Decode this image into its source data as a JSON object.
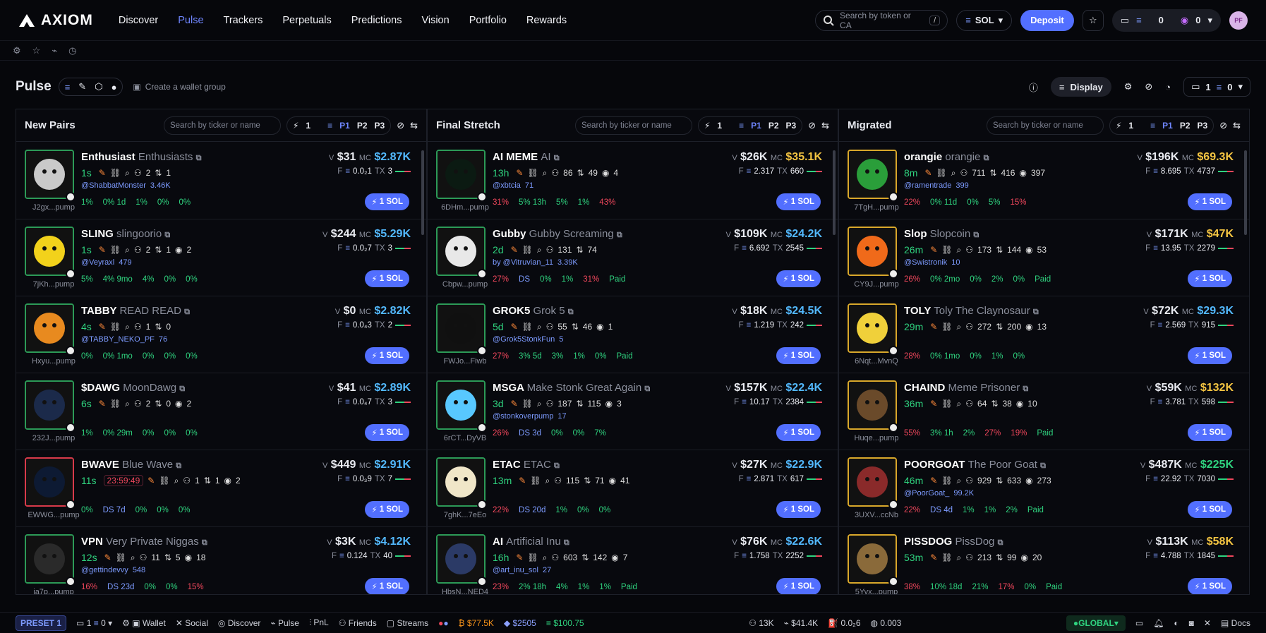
{
  "brand": {
    "name": "AXIOM"
  },
  "nav": [
    "Discover",
    "Pulse",
    "Trackers",
    "Perpetuals",
    "Predictions",
    "Vision",
    "Portfolio",
    "Rewards"
  ],
  "search": {
    "placeholder": "Search by token or CA",
    "shortcut": "/"
  },
  "chain": "SOL",
  "deposit_label": "Deposit",
  "wallet": {
    "balance1": "0",
    "balance2": "0"
  },
  "avatar": "PF",
  "pulse": {
    "title": "Pulse",
    "create_group": "Create a wallet group",
    "display": "Display",
    "boxcount": "1",
    "boxbal": "0"
  },
  "columns": [
    {
      "title": "New Pairs",
      "search_placeholder": "Search by ticker or name",
      "count": "1",
      "cards": [
        {
          "ticker": "Enthusiast",
          "name": "Enthusiasts",
          "age": "1s",
          "addr": "J2gx...pump",
          "handle": "@ShabbatMonster",
          "followers": "3.46K",
          "v": "$31",
          "mc": "$2.87K",
          "f": "0.0₂1",
          "tx": "3",
          "stats": [
            "1%",
            "0% 1d",
            "1%",
            "0%",
            "0%"
          ],
          "counts": [
            "2",
            "1",
            ""
          ],
          "border": "green",
          "mcolor": "blue"
        },
        {
          "ticker": "SLING",
          "name": "slingoorio",
          "age": "1s",
          "addr": "7jKh...pump",
          "handle": "@Veyraxl",
          "followers": "479",
          "v": "$244",
          "mc": "$5.29K",
          "f": "0.0₂7",
          "tx": "3",
          "stats": [
            "5%",
            "4% 9mo",
            "4%",
            "0%",
            "0%"
          ],
          "counts": [
            "2",
            "1",
            "2"
          ],
          "border": "green",
          "mcolor": "blue"
        },
        {
          "ticker": "TABBY",
          "name": "READ READ",
          "age": "4s",
          "addr": "Hxyu...pump",
          "handle": "@TABBY_NEKO_PF",
          "followers": "76",
          "v": "$0",
          "mc": "$2.82K",
          "f": "0.0₄3",
          "tx": "2",
          "stats": [
            "0%",
            "0% 1mo",
            "0%",
            "0%",
            "0%"
          ],
          "counts": [
            "1",
            "0",
            ""
          ],
          "border": "green",
          "mcolor": "blue"
        },
        {
          "ticker": "$DAWG",
          "name": "MoonDawg",
          "age": "6s",
          "addr": "232J...pump",
          "handle": "",
          "followers": "",
          "v": "$41",
          "mc": "$2.89K",
          "f": "0.0₄7",
          "tx": "3",
          "stats": [
            "1%",
            "0% 29m",
            "0%",
            "0%",
            "0%"
          ],
          "counts": [
            "2",
            "0",
            "2"
          ],
          "border": "green",
          "mcolor": "blue"
        },
        {
          "ticker": "BWAVE",
          "name": "Blue Wave",
          "age": "11s",
          "addr": "EWWG...pump",
          "handle": "",
          "followers": "",
          "v": "$449",
          "mc": "$2.91K",
          "f": "0.0₃9",
          "tx": "7",
          "stats": [
            "0%",
            "DS 7d",
            "0%",
            "0%",
            "0%"
          ],
          "counts": [
            "1",
            "1",
            "2"
          ],
          "timer": "23:59:49",
          "border": "red",
          "mcolor": "blue"
        },
        {
          "ticker": "VPN",
          "name": "Very Private Niggas",
          "age": "12s",
          "addr": "ja7p...pump",
          "handle": "@gettindevvy",
          "followers": "548",
          "v": "$3K",
          "mc": "$4.12K",
          "f": "0.124",
          "tx": "40",
          "stats": [
            "16%",
            "DS 23d",
            "0%",
            "0%",
            "15%"
          ],
          "counts": [
            "11",
            "5",
            "18"
          ],
          "border": "green",
          "mcolor": "blue"
        }
      ]
    },
    {
      "title": "Final Stretch",
      "search_placeholder": "Search by ticker or name",
      "count": "1",
      "cards": [
        {
          "ticker": "AI MEME",
          "name": "AI",
          "age": "13h",
          "addr": "6DHm...pump",
          "handle": "@xbtcia",
          "followers": "71",
          "v": "$26K",
          "mc": "$35.1K",
          "f": "2.317",
          "tx": "660",
          "stats": [
            "31%",
            "5% 13h",
            "5%",
            "1%",
            "43%"
          ],
          "counts": [
            "86",
            "49",
            "4"
          ],
          "border": "green",
          "mcolor": "yellow"
        },
        {
          "ticker": "Gubby",
          "name": "Gubby Screaming",
          "age": "2d",
          "addr": "Cbpw...pump",
          "handle": "by @Vitruvian_11",
          "followers": "3.39K",
          "v": "$109K",
          "mc": "$24.2K",
          "f": "6.692",
          "tx": "2545",
          "stats": [
            "27%",
            "DS",
            "0%",
            "1%",
            "31%",
            "Paid"
          ],
          "counts": [
            "131",
            "74",
            ""
          ],
          "border": "green",
          "mcolor": "blue"
        },
        {
          "ticker": "GROK5",
          "name": "Grok 5",
          "age": "5d",
          "addr": "FWJo...Fiwb",
          "handle": "@Grok5StonkFun",
          "followers": "5",
          "v": "$18K",
          "mc": "$24.5K",
          "f": "1.219",
          "tx": "242",
          "stats": [
            "27%",
            "3% 5d",
            "3%",
            "1%",
            "0%",
            "Paid"
          ],
          "counts": [
            "55",
            "46",
            "1"
          ],
          "border": "green",
          "mcolor": "blue"
        },
        {
          "ticker": "MSGA",
          "name": "Make Stonk Great Again",
          "age": "3d",
          "addr": "6rCT...DyVB",
          "handle": "@stonkoverpump",
          "followers": "17",
          "v": "$157K",
          "mc": "$22.4K",
          "f": "10.17",
          "tx": "2384",
          "stats": [
            "26%",
            "DS 3d",
            "0%",
            "0%",
            "7%"
          ],
          "counts": [
            "187",
            "115",
            "3"
          ],
          "border": "green",
          "mcolor": "blue"
        },
        {
          "ticker": "ETAC",
          "name": "ETAC",
          "age": "13m",
          "addr": "7ghK...7eEo",
          "handle": "",
          "followers": "",
          "v": "$27K",
          "mc": "$22.9K",
          "f": "2.871",
          "tx": "617",
          "stats": [
            "22%",
            "DS 20d",
            "1%",
            "0%",
            "0%"
          ],
          "counts": [
            "115",
            "71",
            "41"
          ],
          "border": "green",
          "mcolor": "blue"
        },
        {
          "ticker": "AI",
          "name": "Artificial Inu",
          "age": "16h",
          "addr": "HbsN...NED4",
          "handle": "@art_inu_sol",
          "followers": "27",
          "v": "$76K",
          "mc": "$22.6K",
          "f": "1.758",
          "tx": "2252",
          "stats": [
            "23%",
            "2% 18h",
            "4%",
            "1%",
            "1%",
            "Paid"
          ],
          "counts": [
            "603",
            "142",
            "7"
          ],
          "border": "green",
          "mcolor": "blue"
        }
      ]
    },
    {
      "title": "Migrated",
      "search_placeholder": "Search by ticker or name",
      "count": "1",
      "cards": [
        {
          "ticker": "orangie",
          "name": "orangie",
          "age": "8m",
          "addr": "7TgH...pump",
          "handle": "@ramentrade",
          "followers": "399",
          "v": "$196K",
          "mc": "$69.3K",
          "f": "8.695",
          "tx": "4737",
          "stats": [
            "22%",
            "0% 11d",
            "0%",
            "5%",
            "15%"
          ],
          "counts": [
            "711",
            "416",
            "397"
          ],
          "border": "gold",
          "mcolor": "yellow"
        },
        {
          "ticker": "Slop",
          "name": "Slopcoin",
          "age": "26m",
          "addr": "CY9J...pump",
          "handle": "@Swistronik",
          "followers": "10",
          "v": "$171K",
          "mc": "$47K",
          "f": "13.95",
          "tx": "2279",
          "stats": [
            "26%",
            "0% 2mo",
            "0%",
            "2%",
            "0%",
            "Paid"
          ],
          "counts": [
            "173",
            "144",
            "53"
          ],
          "border": "gold",
          "mcolor": "yellow"
        },
        {
          "ticker": "TOLY",
          "name": "Toly The Claynosaur",
          "age": "29m",
          "addr": "6Nqt...MvnQ",
          "handle": "",
          "followers": "",
          "v": "$72K",
          "mc": "$29.3K",
          "f": "2.569",
          "tx": "915",
          "stats": [
            "28%",
            "0% 1mo",
            "0%",
            "1%",
            "0%"
          ],
          "counts": [
            "272",
            "200",
            "13"
          ],
          "border": "gold",
          "mcolor": "blue"
        },
        {
          "ticker": "CHAIND",
          "name": "Meme Prisoner",
          "age": "36m",
          "addr": "Huqe...pump",
          "handle": "",
          "followers": "",
          "v": "$59K",
          "mc": "$132K",
          "f": "3.781",
          "tx": "598",
          "stats": [
            "55%",
            "3% 1h",
            "2%",
            "27%",
            "19%",
            "Paid"
          ],
          "counts": [
            "64",
            "38",
            "10"
          ],
          "border": "gold",
          "mcolor": "yellow"
        },
        {
          "ticker": "POORGOAT",
          "name": "The Poor Goat",
          "age": "46m",
          "addr": "3UXV...ccNb",
          "handle": "@PoorGoat_",
          "followers": "99.2K",
          "v": "$487K",
          "mc": "$225K",
          "f": "22.92",
          "tx": "7030",
          "stats": [
            "22%",
            "DS 4d",
            "1%",
            "1%",
            "2%",
            "Paid"
          ],
          "counts": [
            "929",
            "633",
            "273"
          ],
          "border": "gold",
          "mcolor": "green"
        },
        {
          "ticker": "PISSDOG",
          "name": "PissDog",
          "age": "53m",
          "addr": "5Yvx...pump",
          "handle": "",
          "followers": "",
          "v": "$113K",
          "mc": "$58K",
          "f": "4.788",
          "tx": "1845",
          "stats": [
            "38%",
            "10% 18d",
            "21%",
            "17%",
            "0%",
            "Paid"
          ],
          "counts": [
            "213",
            "99",
            "20"
          ],
          "border": "gold",
          "mcolor": "yellow"
        }
      ]
    }
  ],
  "solbtn": "1 SOL",
  "footer": {
    "preset": "PRESET 1",
    "wallets": "1",
    "bal": "0",
    "wallet": "Wallet",
    "social": "Social",
    "discover": "Discover",
    "pulse": "Pulse",
    "pnl": "PnL",
    "friends": "Friends",
    "streams": "Streams",
    "btc": "$77.5K",
    "eth": "$2505",
    "sol": "$100.75",
    "s1": "13K",
    "s2": "$41.4K",
    "s3": "0.0₂6",
    "s4": "0.003",
    "global": "GLOBAL",
    "docs": "Docs"
  }
}
